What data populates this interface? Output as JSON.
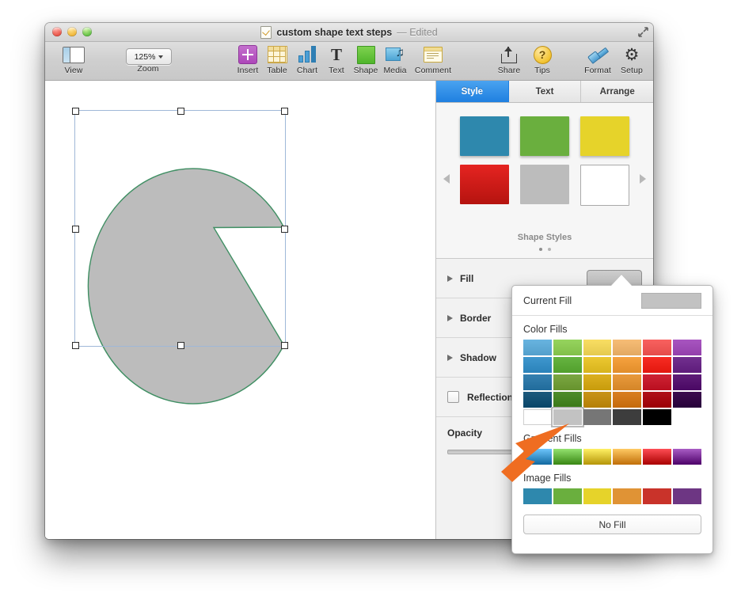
{
  "window": {
    "title": "custom shape text steps",
    "title_suffix": "— Edited",
    "doc_icon": "document-icon",
    "fullscreen_icon": "fullscreen-icon",
    "traffic_lights": [
      "close",
      "minimize",
      "zoom"
    ]
  },
  "toolbar": {
    "items": [
      {
        "label": "View",
        "icon": "view-panel-icon"
      },
      {
        "label": "Zoom",
        "icon": "zoom-popup-icon",
        "value": "125%"
      },
      {
        "label": "Insert",
        "icon": "insert-plus-icon"
      },
      {
        "label": "Table",
        "icon": "table-icon"
      },
      {
        "label": "Chart",
        "icon": "bar-chart-icon"
      },
      {
        "label": "Text",
        "icon": "text-t-icon"
      },
      {
        "label": "Shape",
        "icon": "shape-square-icon"
      },
      {
        "label": "Media",
        "icon": "media-photo-note-icon"
      },
      {
        "label": "Comment",
        "icon": "comment-note-icon"
      },
      {
        "label": "Share",
        "icon": "share-upload-icon"
      },
      {
        "label": "Tips",
        "icon": "tips-question-icon"
      },
      {
        "label": "Format",
        "icon": "format-brush-icon"
      },
      {
        "label": "Setup",
        "icon": "setup-gear-icon"
      }
    ]
  },
  "canvas": {
    "shape": {
      "name": "pacman-wedge-shape",
      "fill": "#bcbcbc",
      "stroke": "#3f8f63"
    },
    "selection": {
      "border_color": "#9fb8d8",
      "handle_count": 8
    }
  },
  "inspector": {
    "tabs": [
      {
        "label": "Style",
        "active": true
      },
      {
        "label": "Text",
        "active": false
      },
      {
        "label": "Arrange",
        "active": false
      }
    ],
    "shape_styles": {
      "caption": "Shape Styles",
      "swatches": [
        "#2e88ad",
        "#6aaf3e",
        "#e6d32a",
        "#e52421",
        "#bcbcbc",
        "#ffffff"
      ],
      "page_dots": 2,
      "active_dot": 1
    },
    "sections": [
      {
        "label": "Fill",
        "type": "disclosure",
        "swatch": "#c5c5c5"
      },
      {
        "label": "Border",
        "type": "disclosure"
      },
      {
        "label": "Shadow",
        "type": "disclosure"
      },
      {
        "label": "Reflection",
        "type": "checkbox",
        "checked": false
      },
      {
        "label": "Opacity",
        "type": "slider",
        "value": 0
      }
    ]
  },
  "fill_popover": {
    "current_fill_label": "Current Fill",
    "current_fill_color": "#c2c2c2",
    "color_fills_label": "Color Fills",
    "gradient_fills_label": "Gradient Fills",
    "image_fills_label": "Image Fills",
    "no_fill_label": "No Fill",
    "selected_swatch": "#c2c2c2",
    "color_fills": [
      [
        "#68b4e0",
        "#96d45e",
        "#f9de63",
        "#f7bd76",
        "#f9615f",
        "#a855c0"
      ],
      [
        "#3f97ce",
        "#66b441",
        "#ecc831",
        "#f6a23f",
        "#f72c23",
        "#72308f"
      ],
      [
        "#3580b0",
        "#7ba742",
        "#dcb020",
        "#e99a3c",
        "#ce2334",
        "#5e1c78"
      ],
      [
        "#1d5a7d",
        "#4f8d2c",
        "#c9941a",
        "#d97f21",
        "#b0121a",
        "#3c0d4e"
      ],
      [
        "#ffffff",
        "#c2c2c2",
        "#767676",
        "#3d3d3d",
        "#000000",
        ""
      ]
    ],
    "gradient_fills": [
      "#3f97ce",
      "#66b441",
      "#e3c336",
      "#ee9c36",
      "#d72027",
      "#7b2f97"
    ],
    "image_fills": [
      "#2e88ad",
      "#6aaf3e",
      "#e6d32a",
      "#e09335",
      "#c9332a",
      "#6d3683"
    ]
  },
  "annotation": {
    "cursor": "orange-arrow-pointer",
    "color": "#ef6d21"
  }
}
